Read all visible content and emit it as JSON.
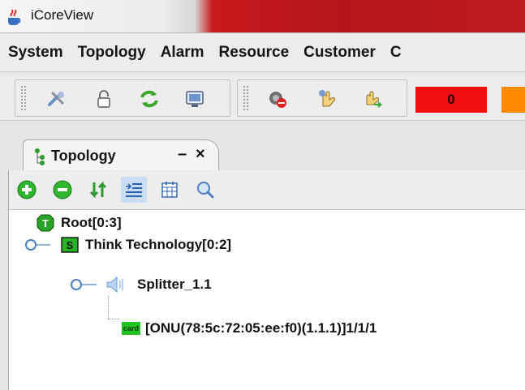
{
  "window": {
    "title": "iCoreView"
  },
  "menu": [
    "System",
    "Topology",
    "Alarm",
    "Resource",
    "Customer",
    "C"
  ],
  "toolbar": {
    "buttons": [
      "tools-icon",
      "lock-icon",
      "refresh-icon",
      "monitor-icon",
      "no-sound-icon",
      "hand-icon",
      "hand-arrow-icon"
    ],
    "alarm_counters": [
      {
        "value": "0",
        "color": "#f20e0e"
      },
      {
        "value": "",
        "color": "#ff8a00"
      }
    ]
  },
  "tab": {
    "label": "Topology",
    "minimize": "–",
    "close": "×"
  },
  "panel_toolbar": [
    "add-icon",
    "remove-icon",
    "sync-icon",
    "indent-icon",
    "calendar-icon",
    "search-icon"
  ],
  "tree": {
    "root": {
      "label": "Root[0:3]",
      "badge": "T"
    },
    "level1": {
      "label": "Think Technology[0:2]",
      "badge": "S"
    },
    "level2": {
      "label": "Splitter_1.1"
    },
    "level3": {
      "label": "[ONU(78:5c:72:05:ee:f0)(1.1.1)]1/1/1",
      "badge": "card"
    }
  }
}
